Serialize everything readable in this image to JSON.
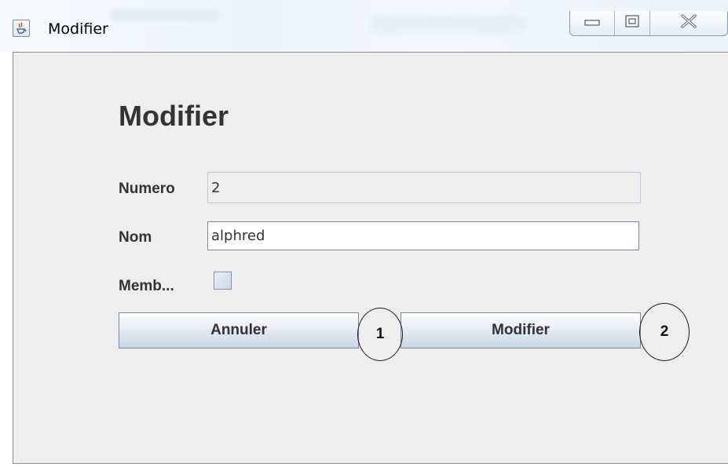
{
  "window": {
    "title": "Modifier",
    "controls": {
      "minimize_icon": "minimize-icon",
      "maximize_icon": "maximize-icon",
      "close_icon": "close-icon"
    }
  },
  "form": {
    "heading": "Modifier",
    "fields": {
      "numero": {
        "label": "Numero",
        "value": "2",
        "editable": false
      },
      "nom": {
        "label": "Nom",
        "value": "alphred",
        "editable": true
      },
      "membre": {
        "label": "Memb...",
        "checked": false
      }
    },
    "buttons": {
      "annuler": "Annuler",
      "modifier": "Modifier"
    },
    "annotations": {
      "first": "1",
      "second": "2"
    }
  },
  "colors": {
    "panel_background": "#eeeeee",
    "text": "#333333",
    "button_gradient_end": "#c8d6e5"
  }
}
